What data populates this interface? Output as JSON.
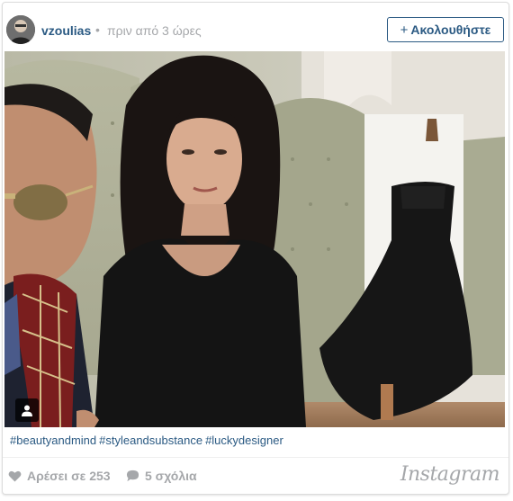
{
  "post": {
    "username": "vzoulias",
    "separator": "•",
    "time_ago": "πριν από 3 ώρες",
    "follow_label": "Ακολουθήστε",
    "follow_icon": "plus-icon"
  },
  "caption": {
    "hashtags": [
      "#beautyandmind",
      "#styleandsubstance",
      "#luckydesigner"
    ]
  },
  "footer": {
    "likes_label": "Αρέσει σε 253",
    "comments_label": "5 σχόλια",
    "brand": "Instagram"
  },
  "colors": {
    "link": "#2b5a83",
    "muted": "#a5a7aa",
    "border": "#dcdcdc"
  }
}
